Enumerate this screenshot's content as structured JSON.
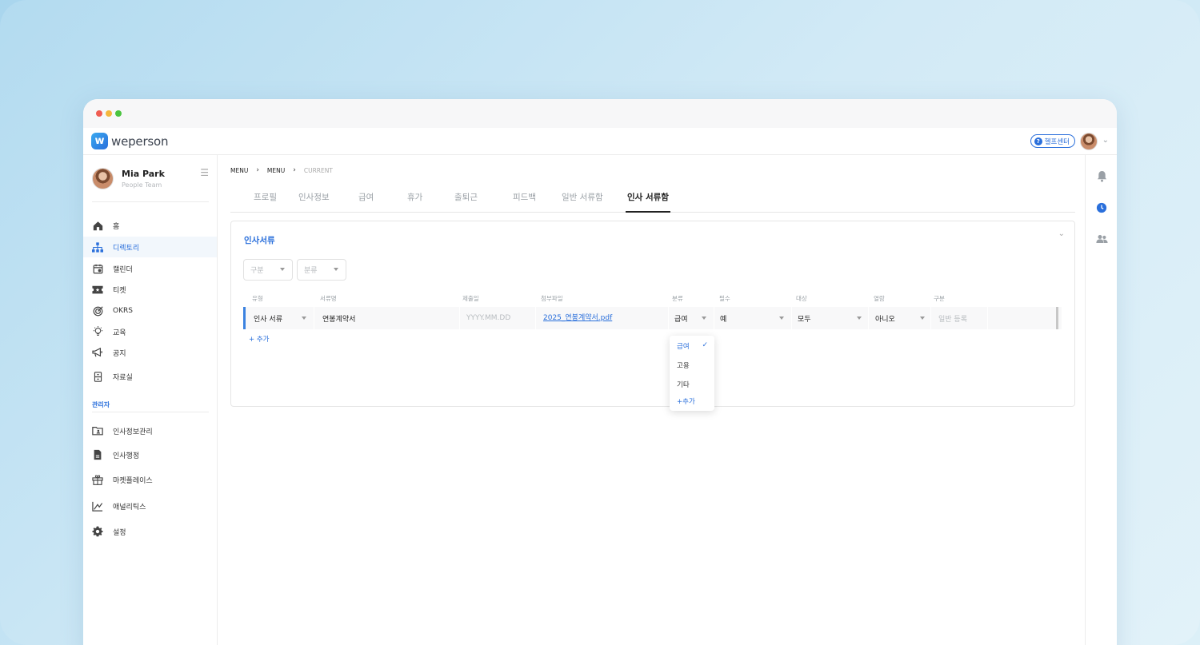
{
  "app": {
    "logo_text": "weperson",
    "help_label": "헬프센터"
  },
  "profile": {
    "name": "Mia Park",
    "team": "People Team"
  },
  "nav": [
    {
      "label": "홈",
      "icon": "home-icon"
    },
    {
      "label": "디렉토리",
      "icon": "org-chart-icon",
      "active": true
    },
    {
      "label": "캘린더",
      "icon": "calendar-icon"
    },
    {
      "label": "티켓",
      "icon": "ticket-icon"
    },
    {
      "label": "OKRS",
      "icon": "target-icon"
    },
    {
      "label": "교육",
      "icon": "lightbulb-icon"
    },
    {
      "label": "공지",
      "icon": "megaphone-icon"
    },
    {
      "label": "자료실",
      "icon": "archive-icon"
    }
  ],
  "admin": {
    "label": "관리자",
    "items": [
      {
        "label": "인사정보관리",
        "icon": "folder-user-icon"
      },
      {
        "label": "인사행정",
        "icon": "document-icon"
      },
      {
        "label": "마켓플레이스",
        "icon": "gift-icon"
      },
      {
        "label": "애널리틱스",
        "icon": "analytics-icon"
      },
      {
        "label": "설정",
        "icon": "gear-icon"
      }
    ]
  },
  "breadcrumb": {
    "first": "MENU",
    "second": "MENU",
    "current": "CURRENT"
  },
  "tabs": [
    "프로필",
    "인사정보",
    "급여",
    "휴가",
    "출퇴근",
    "피드백",
    "일반 서류함",
    "인사 서류함"
  ],
  "active_tab_index": 7,
  "section": {
    "title": "인사서류",
    "filters": {
      "category": "구분",
      "classification": "분류"
    },
    "columns": [
      "유형",
      "서류명",
      "제출일",
      "첨부파일",
      "분류",
      "필수",
      "대상",
      "열람",
      "구분"
    ],
    "row": {
      "type": "인사 서류",
      "name": "연봉계약서",
      "date_placeholder": "YYYY.MM.DD",
      "attachment": "2025_연봉계약서.pdf",
      "classification": "급여",
      "required": "예",
      "target": "모두",
      "view": "아니오",
      "category_placeholder": "일반 등록"
    },
    "add_label": "+ 추가",
    "dropdown": {
      "options": [
        "급여",
        "고용",
        "기타"
      ],
      "selected": "급여",
      "add_label": "+추가"
    }
  }
}
